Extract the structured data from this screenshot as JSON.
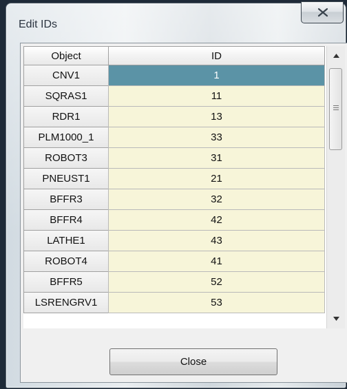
{
  "window": {
    "title": "Edit IDs"
  },
  "table": {
    "headers": {
      "object": "Object",
      "id": "ID"
    },
    "rows": [
      {
        "object": "CNV1",
        "id": "1",
        "selected": true
      },
      {
        "object": "SQRAS1",
        "id": "11"
      },
      {
        "object": "RDR1",
        "id": "13"
      },
      {
        "object": "PLM1000_1",
        "id": "33"
      },
      {
        "object": "ROBOT3",
        "id": "31"
      },
      {
        "object": "PNEUST1",
        "id": "21"
      },
      {
        "object": "BFFR3",
        "id": "32"
      },
      {
        "object": "BFFR4",
        "id": "42"
      },
      {
        "object": "LATHE1",
        "id": "43"
      },
      {
        "object": "ROBOT4",
        "id": "41"
      },
      {
        "object": "BFFR5",
        "id": "52"
      },
      {
        "object": "LSRENGRV1",
        "id": "53"
      }
    ]
  },
  "buttons": {
    "close": "Close"
  },
  "icons": {
    "title_close": "close-icon",
    "scroll_up": "arrow-up-icon",
    "scroll_down": "arrow-down-icon"
  },
  "colors": {
    "selected_cell": "#5b93a6",
    "id_cell_bg": "#f7f5d9"
  }
}
